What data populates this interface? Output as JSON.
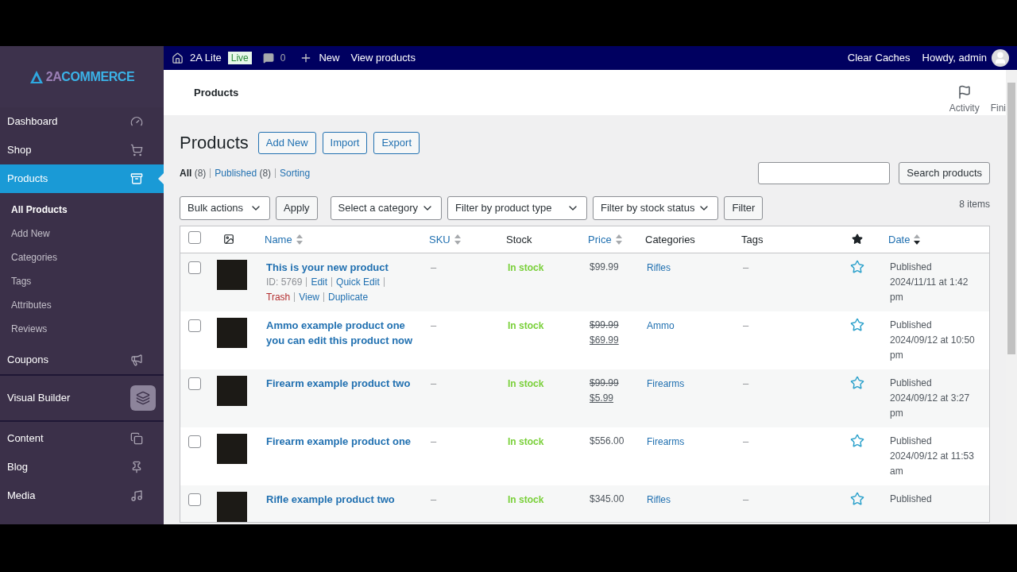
{
  "admin_bar": {
    "site": "2A Lite",
    "badge": "Live",
    "comments": "0",
    "new": "New",
    "view": "View products",
    "clear": "Clear Caches",
    "howdy": "Howdy, admin"
  },
  "sidebar": {
    "logo_a": "2A",
    "logo_b": "COMMERCE",
    "sections": [
      [
        {
          "label": "Dashboard",
          "selected": false
        },
        {
          "label": "Shop",
          "selected": false
        },
        {
          "label": "Products",
          "selected": true,
          "children": [
            {
              "label": "All Products",
              "selected": true
            },
            {
              "label": "Add New",
              "selected": false
            },
            {
              "label": "Categories",
              "selected": false
            },
            {
              "label": "Tags",
              "selected": false
            },
            {
              "label": "Attributes",
              "selected": false
            },
            {
              "label": "Reviews",
              "selected": false
            }
          ]
        },
        {
          "label": "Coupons",
          "selected": false
        }
      ],
      [
        {
          "label": "Visual Builder",
          "selected": false,
          "kind": "boxed"
        }
      ],
      [
        {
          "label": "Content",
          "selected": false
        },
        {
          "label": "Blog",
          "selected": false
        },
        {
          "label": "Media",
          "selected": false
        }
      ]
    ]
  },
  "header": {
    "title": "Products",
    "actions": [
      "Activity",
      "Fini"
    ]
  },
  "page": {
    "title": "Products",
    "buttons": [
      "Add New",
      "Import",
      "Export"
    ],
    "views": [
      {
        "label": "All",
        "count": "(8)",
        "selected": true
      },
      {
        "label": "Published",
        "count": "(8)",
        "selected": false
      },
      {
        "label": "Sorting",
        "selected": false
      }
    ],
    "search": {
      "button": "Search products"
    },
    "bulk": "Bulk actions",
    "apply": "Apply",
    "filters": [
      "Select a category",
      "Filter by product type",
      "Filter by stock status"
    ],
    "filter_button": "Filter",
    "count": "8 items"
  },
  "table": {
    "select_all": {
      "checked": false
    },
    "columns": [
      {
        "kind": "image"
      },
      {
        "label": "Name",
        "sortable": true,
        "sorted": false
      },
      {
        "label": "SKU",
        "sortable": true,
        "sorted": false
      },
      {
        "label": "Stock",
        "sortable": false
      },
      {
        "label": "Price",
        "sortable": true,
        "sorted": false
      },
      {
        "label": "Categories",
        "sortable": false
      },
      {
        "label": "Tags",
        "sortable": false
      },
      {
        "kind": "featured"
      },
      {
        "label": "Date",
        "sortable": true,
        "sorted": true
      }
    ],
    "rows": [
      {
        "checked": false,
        "name": "This is your new product",
        "actions": [
          {
            "text": "ID: 5769",
            "kind": "meta"
          },
          {
            "text": "Edit",
            "kind": "link"
          },
          {
            "text": "Quick Edit",
            "kind": "link"
          },
          {
            "text": "Trash",
            "kind": "danger"
          },
          {
            "text": "View",
            "kind": "link"
          },
          {
            "text": "Duplicate",
            "kind": "link"
          }
        ],
        "sku": "–",
        "stock": "In stock",
        "price": "$99.99",
        "categories": "Rifles",
        "tags": "–",
        "featured": false,
        "status": "Published",
        "date": "2024/11/11 at 1:42 pm"
      },
      {
        "checked": false,
        "name": "Ammo example product one you can edit this product now",
        "sku": "–",
        "stock": "In stock",
        "regular_price": "$99.99",
        "price": "$69.99",
        "categories": "Ammo",
        "tags": "–",
        "featured": false,
        "status": "Published",
        "date": "2024/09/12 at 10:50 pm"
      },
      {
        "checked": false,
        "name": "Firearm example product two",
        "sku": "–",
        "stock": "In stock",
        "regular_price": "$99.99",
        "price": "$5.99",
        "categories": "Firearms",
        "tags": "–",
        "featured": false,
        "status": "Published",
        "date": "2024/09/12 at 3:27 pm"
      },
      {
        "checked": false,
        "name": "Firearm example product one",
        "sku": "–",
        "stock": "In stock",
        "price": "$556.00",
        "categories": "Firearms",
        "tags": "–",
        "featured": false,
        "status": "Published",
        "date": "2024/09/12 at 11:53 am"
      },
      {
        "checked": false,
        "name": "Rifle example product two",
        "sku": "–",
        "stock": "In stock",
        "price": "$345.00",
        "categories": "Rifles",
        "tags": "–",
        "featured": false,
        "status": "Published"
      }
    ]
  }
}
